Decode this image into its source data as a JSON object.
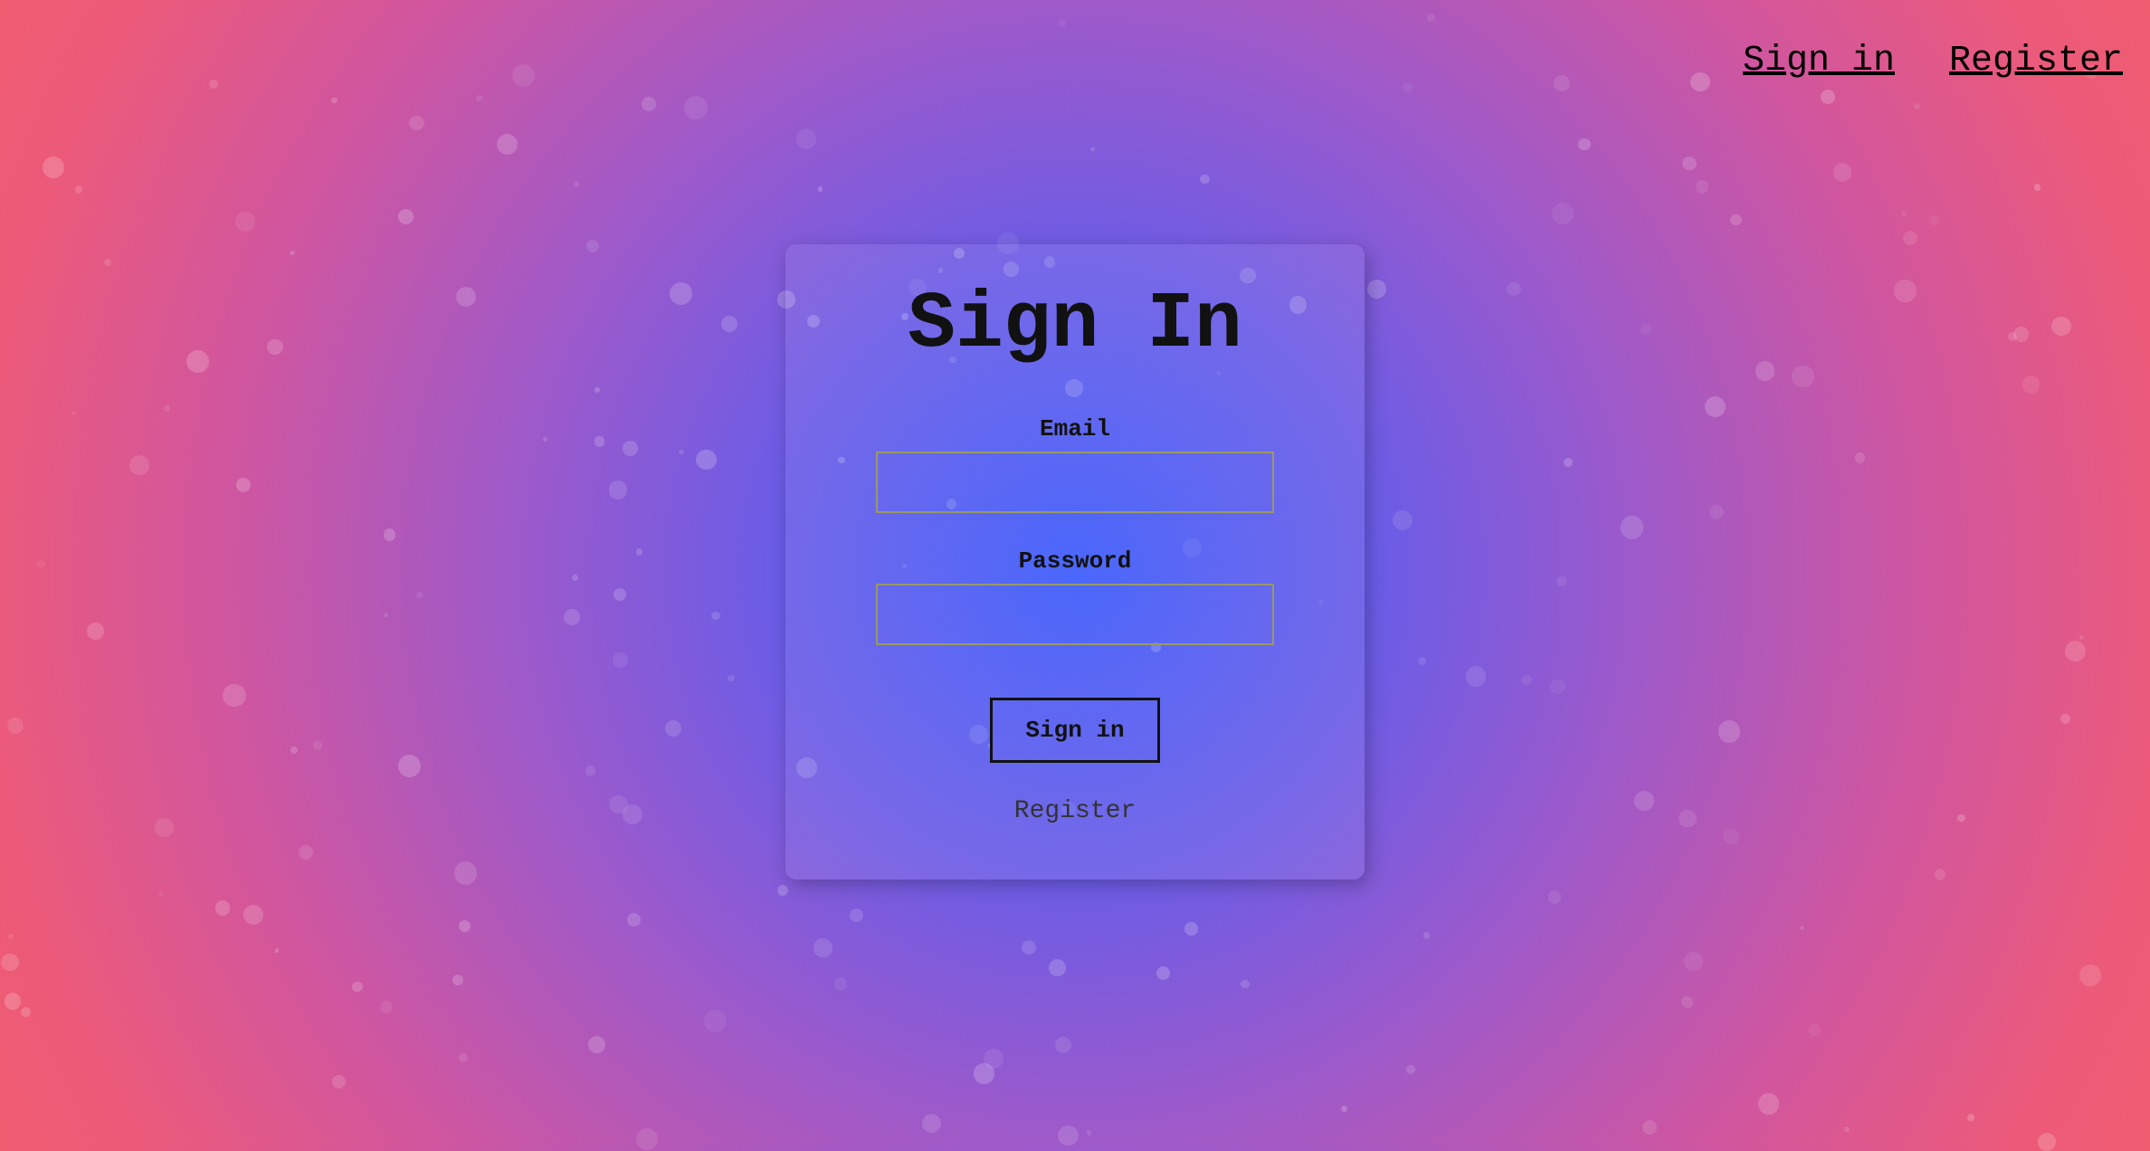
{
  "nav": {
    "signin": "Sign in",
    "register": "Register"
  },
  "card": {
    "title": "Sign In",
    "email_label": "Email",
    "password_label": "Password",
    "submit_label": "Sign in",
    "register_link": "Register"
  }
}
